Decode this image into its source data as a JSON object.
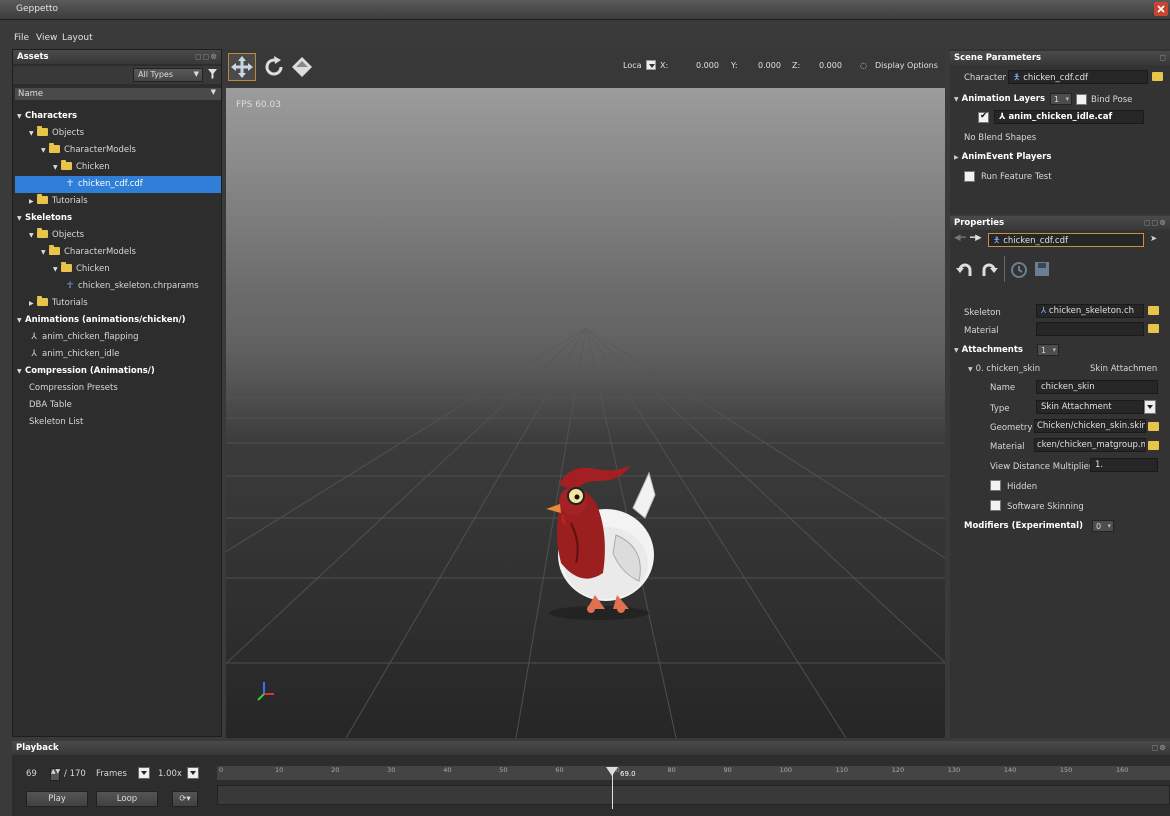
{
  "app": {
    "title": "Geppetto"
  },
  "menu": [
    {
      "label": "File",
      "key": "F"
    },
    {
      "label": "View",
      "key": "V"
    },
    {
      "label": "Layout",
      "key": "L"
    }
  ],
  "assets": {
    "title": "Assets",
    "filter_value": "All Types",
    "column_header": "Name",
    "tree": [
      {
        "label": "Characters",
        "level": 0,
        "kind": "root",
        "expanded": true
      },
      {
        "label": "Objects",
        "level": 1,
        "kind": "folder",
        "expanded": true
      },
      {
        "label": "CharacterModels",
        "level": 2,
        "kind": "folder",
        "expanded": true
      },
      {
        "label": "Chicken",
        "level": 3,
        "kind": "folder",
        "expanded": true
      },
      {
        "label": "chicken_cdf.cdf",
        "level": 4,
        "kind": "character",
        "selected": true
      },
      {
        "label": "Tutorials",
        "level": 1,
        "kind": "folder",
        "expanded": false
      },
      {
        "label": "Skeletons",
        "level": 0,
        "kind": "root",
        "expanded": true
      },
      {
        "label": "Objects",
        "level": 1,
        "kind": "folder",
        "expanded": true
      },
      {
        "label": "CharacterModels",
        "level": 2,
        "kind": "folder",
        "expanded": true
      },
      {
        "label": "Chicken",
        "level": 3,
        "kind": "folder",
        "expanded": true
      },
      {
        "label": "chicken_skeleton.chrparams",
        "level": 4,
        "kind": "skeleton"
      },
      {
        "label": "Tutorials",
        "level": 1,
        "kind": "folder",
        "expanded": false
      },
      {
        "label": "Animations (animations/chicken/)",
        "level": 0,
        "kind": "root",
        "expanded": true
      },
      {
        "label": "anim_chicken_flapping",
        "level": 1,
        "kind": "anim"
      },
      {
        "label": "anim_chicken_idle",
        "level": 1,
        "kind": "anim"
      },
      {
        "label": "Compression (Animations/)",
        "level": 0,
        "kind": "root",
        "expanded": true
      },
      {
        "label": "Compression Presets",
        "level": 1,
        "kind": "item"
      },
      {
        "label": "DBA Table",
        "level": 1,
        "kind": "item"
      },
      {
        "label": "Skeleton List",
        "level": 1,
        "kind": "item"
      }
    ]
  },
  "viewport": {
    "coord_space": "Loca",
    "x_label": "X:",
    "x_value": "0.000",
    "y_label": "Y:",
    "y_value": "0.000",
    "z_label": "Z:",
    "z_value": "0.000",
    "display_options": "Display Options",
    "fps_label": "FPS",
    "fps_value": "60.03"
  },
  "scene": {
    "title": "Scene Parameters",
    "character_label": "Character",
    "character_value": "chicken_cdf.cdf",
    "anim_layers_label": "Animation Layers",
    "anim_layers_count": "1",
    "bind_pose_label": "Bind Pose",
    "layer_anim": "anim_chicken_idle.caf",
    "no_blend": "No Blend Shapes",
    "animevent_label": "AnimEvent Players",
    "run_feature_label": "Run Feature Test"
  },
  "properties": {
    "title": "Properties",
    "path_value": "chicken_cdf.cdf",
    "skeleton_label": "Skeleton",
    "skeleton_value": "chicken_skeleton.ch",
    "material_label": "Material",
    "material_value": "",
    "attachments_label": "Attachments",
    "attachments_count": "1",
    "attachment_name": "0. chicken_skin",
    "attachment_type_short": "Skin Attachmen",
    "name_label": "Name",
    "name_value": "chicken_skin",
    "type_label": "Type",
    "type_value": "Skin Attachment",
    "geometry_label": "Geometry",
    "geometry_value": "Chicken/chicken_skin.skin",
    "mat_label": "Material",
    "mat_value": "cken/chicken_matgroup.mtl",
    "view_dist_label": "View Distance Multiplier",
    "view_dist_value": "1.",
    "hidden_label": "Hidden",
    "software_skinning_label": "Software Skinning",
    "modifiers_label": "Modifiers (Experimental)",
    "modifiers_count": "0"
  },
  "playback": {
    "title": "Playback",
    "frame": "69",
    "total": "/ 170",
    "frames_label": "Frames",
    "speed": "1.00x",
    "play_label": "Play",
    "loop_label": "Loop",
    "playhead_label": "69.0",
    "ticks": [
      "0",
      "10",
      "20",
      "30",
      "40",
      "50",
      "60",
      "70",
      "80",
      "90",
      "100",
      "110",
      "120",
      "130",
      "140",
      "150",
      "160"
    ]
  },
  "colors": {
    "selection": "#2f7fd8",
    "folder": "#e8c54a",
    "accent_orange": "#c89040",
    "chicken_red": "#9b1f1f"
  }
}
